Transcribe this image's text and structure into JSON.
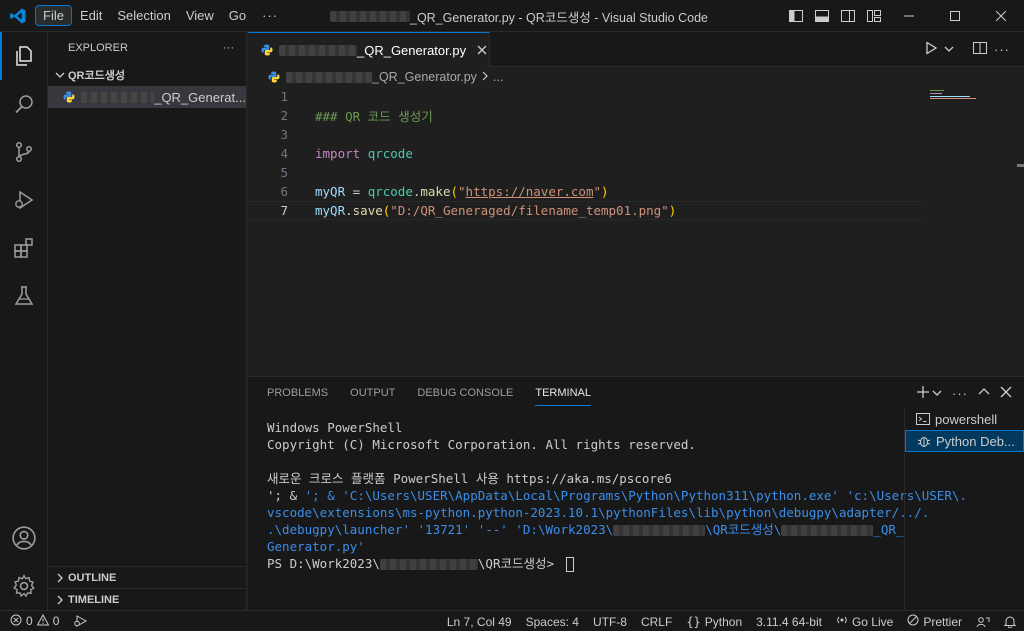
{
  "titlebar": {
    "menu": [
      "File",
      "Edit",
      "Selection",
      "View",
      "Go"
    ],
    "more": "···",
    "title_suffix": "_QR_Generator.py - QR코드생성 - Visual Studio Code"
  },
  "sidebar": {
    "header": "EXPLORER",
    "header_more": "···",
    "folder": "QR코드생성",
    "file_suffix": "_QR_Generat...",
    "outline": "OUTLINE",
    "timeline": "TIMELINE"
  },
  "editor": {
    "tab_suffix": "_QR_Generator.py",
    "breadcrumb_suffix": "_QR_Generator.py",
    "breadcrumb_more": "...",
    "line_numbers": [
      "1",
      "2",
      "3",
      "4",
      "5",
      "6",
      "7"
    ],
    "code": {
      "l2": "### QR 코드 생성기",
      "l4_kw": "import",
      "l4_mod": "qrcode",
      "l6_var": "myQR",
      "l6_eq": " = ",
      "l6_mod": "qrcode",
      "l6_dot": ".",
      "l6_fn": "make",
      "l6_open": "(",
      "l6_q1": "\"",
      "l6_url": "https://naver.com",
      "l6_q2": "\"",
      "l6_close": ")",
      "l7_var": "myQR",
      "l7_dot": ".",
      "l7_fn": "save",
      "l7_open": "(",
      "l7_str": "\"D:/QR_Generaged/filename_temp01.png\"",
      "l7_close": ")"
    }
  },
  "panel": {
    "tabs": [
      "PROBLEMS",
      "OUTPUT",
      "DEBUG CONSOLE",
      "TERMINAL"
    ],
    "terminal_lines": {
      "l1": "Windows PowerShell",
      "l2": "Copyright (C) Microsoft Corporation. All rights reserved.",
      "l3": "새로운 크로스 플랫폼 PowerShell 사용 https://aka.ms/pscore6",
      "l4": "'; & 'C:\\Users\\USER\\AppData\\Local\\Programs\\Python\\Python311\\python.exe' 'c:\\Users\\USER\\.",
      "l5": "vscode\\extensions\\ms-python.python-2023.10.1\\pythonFiles\\lib\\python\\debugpy\\adapter/../.",
      "l6a": ".\\debugpy\\launcher' '13721' '--' 'D:\\Work2023\\",
      "l6b": "\\QR코드생성\\",
      "l6c": "_QR_",
      "l7": "Generator.py'",
      "l8a": "PS D:\\Work2023\\",
      "l8b": "\\QR코드생성> "
    },
    "terminals": [
      "powershell",
      "Python Deb..."
    ]
  },
  "statusbar": {
    "errors": "0",
    "warnings": "0",
    "position": "Ln 7, Col 49",
    "spaces": "Spaces: 4",
    "encoding": "UTF-8",
    "eol": "CRLF",
    "language": "Python",
    "interpreter": "3.11.4 64-bit",
    "golive": "Go Live",
    "prettier": "Prettier"
  },
  "colors": {
    "accent": "#0078d4",
    "python_yellow": "#ffd43b",
    "python_blue": "#3776ab"
  }
}
